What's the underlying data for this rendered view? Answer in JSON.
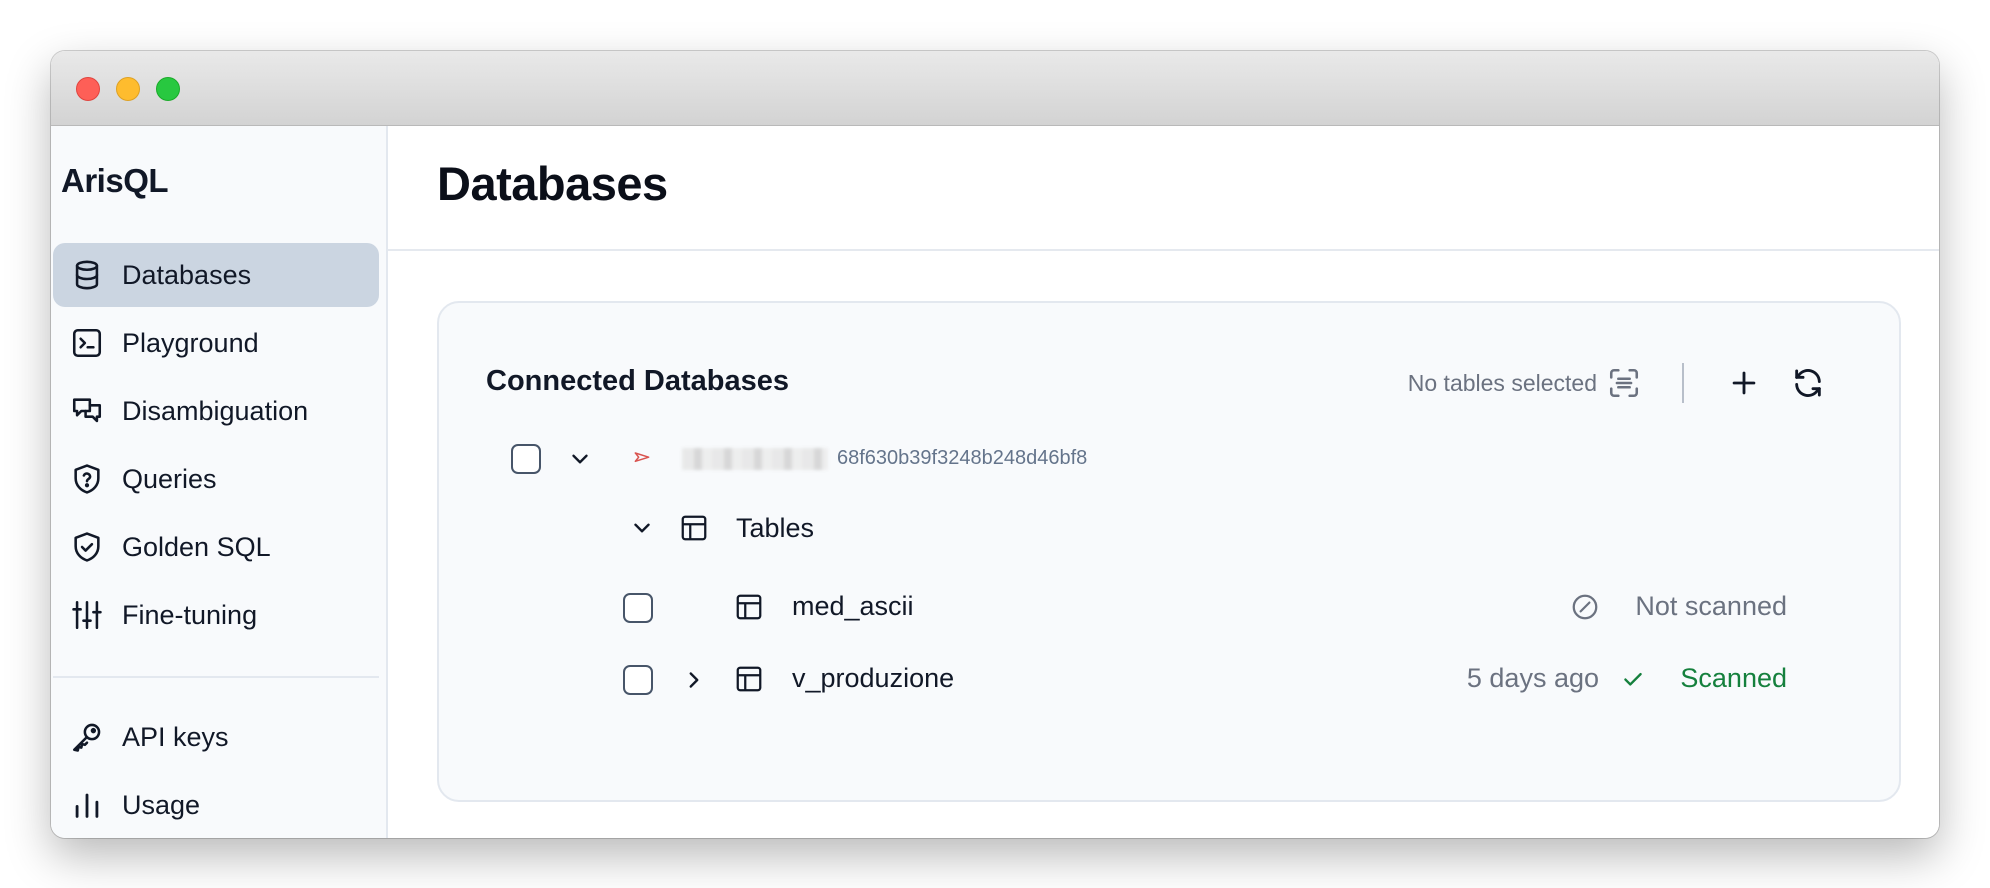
{
  "app": {
    "brand": "ArisQL"
  },
  "sidebar": {
    "items": [
      {
        "label": "Databases",
        "icon": "database-icon",
        "active": true
      },
      {
        "label": "Playground",
        "icon": "terminal-icon"
      },
      {
        "label": "Disambiguation",
        "icon": "chat-bubbles-icon"
      },
      {
        "label": "Queries",
        "icon": "shield-question-icon"
      },
      {
        "label": "Golden SQL",
        "icon": "shield-check-icon"
      },
      {
        "label": "Fine-tuning",
        "icon": "sliders-icon"
      }
    ],
    "bottom_items": [
      {
        "label": "API keys",
        "icon": "key-icon"
      },
      {
        "label": "Usage",
        "icon": "bar-chart-icon"
      }
    ]
  },
  "page": {
    "title": "Databases"
  },
  "connected": {
    "title": "Connected Databases",
    "selection_status": "No tables selected",
    "database": {
      "id": "68f630b39f3248b248d46bf8",
      "tables_label": "Tables",
      "tables": [
        {
          "name": "med_ascii",
          "status": "Not scanned",
          "time": ""
        },
        {
          "name": "v_produzione",
          "status": "Scanned",
          "time": "5 days ago"
        }
      ]
    }
  },
  "colors": {
    "accent_active": "#cbd5e1",
    "scanned": "#15803d",
    "muted": "#6b7280"
  }
}
